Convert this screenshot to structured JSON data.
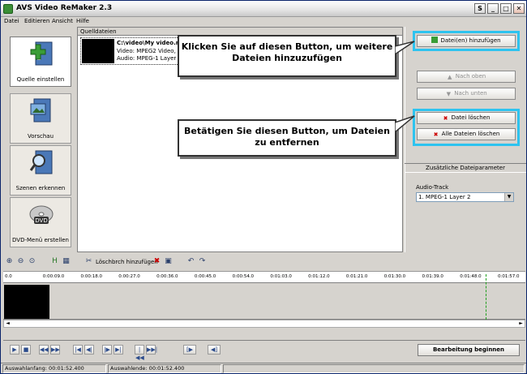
{
  "window": {
    "title": "AVS Video ReMaker 2.3",
    "buttons": [
      "S",
      "_",
      "□",
      "✕"
    ]
  },
  "menu": [
    "Datei",
    "Editieren",
    "Ansicht",
    "Hilfe"
  ],
  "left_panel": [
    {
      "label": "Quelle einstellen",
      "icon": "film-add-icon",
      "selected": true
    },
    {
      "label": "Vorschau",
      "icon": "film-preview-icon"
    },
    {
      "label": "Szenen erkennen",
      "icon": "magnifier-film-icon"
    },
    {
      "label": "DVD-Menü erstellen",
      "icon": "dvd-disc-icon"
    }
  ],
  "file_list": {
    "header": "Quelldateien",
    "items": [
      {
        "name": "C:\\video\\My video.m",
        "video": "Video: MPEG2 Video, 7",
        "audio": "Audio: MPEG-1 Layer 2"
      }
    ]
  },
  "right_panel": {
    "add_files": "Datei(en) hinzufügen",
    "move_up": "Nach oben",
    "move_down": "Nach unten",
    "delete_file": "Datei löschen",
    "delete_all": "Alle Dateien löschen",
    "section_title": "Zusätzliche Dateiparameter",
    "audio_track_label": "Audio-Track",
    "audio_track_value": "1. MPEG-1 Layer 2"
  },
  "callouts": {
    "add": "Klicken Sie auf diesen Button, um weitere Dateien hinzuzufügen",
    "delete": "Betätigen Sie diesen Button, um Dateien zu entfernen"
  },
  "toolbar": {
    "add_mark": "Löschbrch hinzufügen"
  },
  "ruler_ticks": [
    "0.0",
    "0:00:09.0",
    "0:00:18.0",
    "0:00:27.0",
    "0:00:36.0",
    "0:00:45.0",
    "0:00:54.0",
    "0:01:03.0",
    "0:01:12.0",
    "0:01:21.0",
    "0:01:30.0",
    "0:01:39.0",
    "0:01:48.0",
    "0:01:57.0"
  ],
  "playback": {
    "start_button": "Bearbeitung beginnen"
  },
  "status": {
    "start": "Auswahlanfang: 00:01:52.400",
    "end": "Auswahlende: 00:01:52.400"
  },
  "colors": {
    "highlight": "#2ec3ef",
    "accent_green": "#3a8e36"
  }
}
